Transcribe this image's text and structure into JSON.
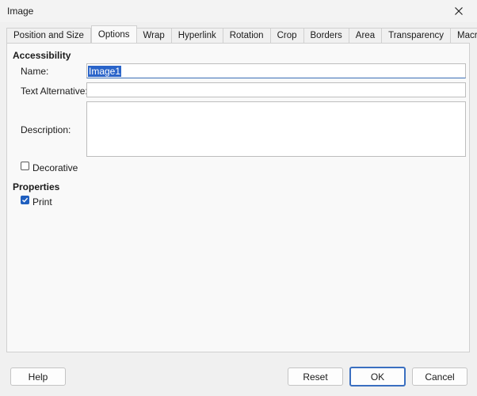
{
  "window": {
    "title": "Image"
  },
  "tabs": [
    "Position and Size",
    "Options",
    "Wrap",
    "Hyperlink",
    "Rotation",
    "Crop",
    "Borders",
    "Area",
    "Transparency",
    "Macro"
  ],
  "accessibility": {
    "heading": "Accessibility",
    "name_label": "Name:",
    "name_value": "Image1",
    "text_alt_label": "Text Alternative:",
    "text_alt_value": "",
    "description_label": "Description:",
    "description_value": "",
    "decorative_label": "Decorative",
    "decorative_checked": false
  },
  "properties": {
    "heading": "Properties",
    "print_label": "Print",
    "print_checked": true
  },
  "buttons": {
    "help": "Help",
    "reset": "Reset",
    "ok": "OK",
    "cancel": "Cancel"
  },
  "colors": {
    "accent": "#1f5fbf",
    "selection": "#2a64c9"
  },
  "icons": {
    "close": "close-icon",
    "check": "checkmark-icon"
  }
}
